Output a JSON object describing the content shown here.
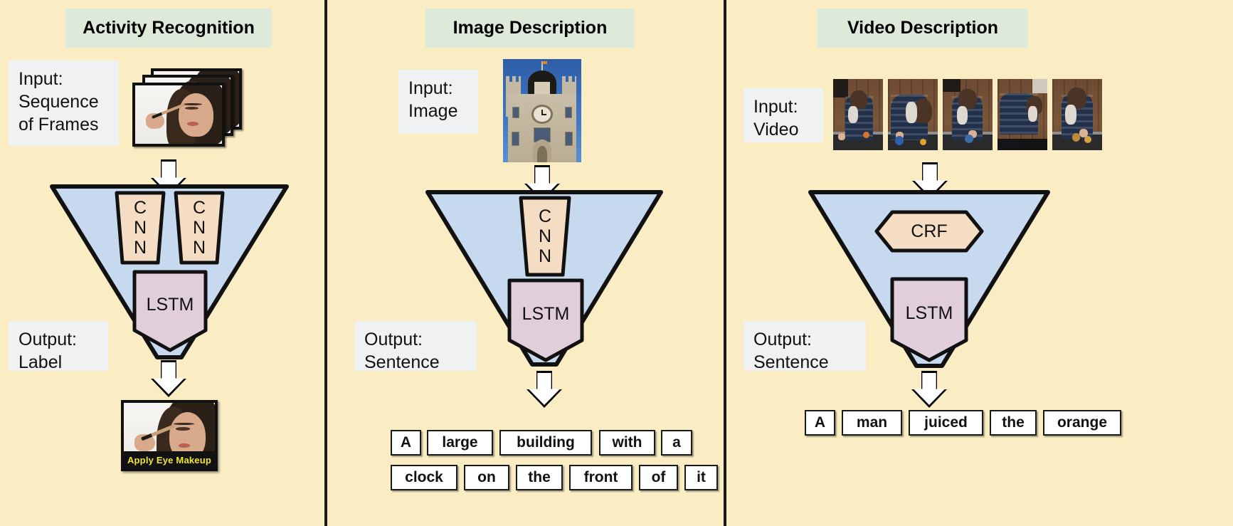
{
  "background_color": "#faedc4",
  "banner_color": "#ddeada",
  "label_box_color": "#f0f1f3",
  "funnel_color": "#c6d9ef",
  "cnn_color": "#f5ddc4",
  "lstm_color": "#e0cedb",
  "panels": [
    {
      "id": "activity",
      "title": "Activity Recognition",
      "input_label": "Input:\nSequence\nof Frames",
      "output_label": "Output:\nLabel",
      "input_media": "frame-stack-thumbnail",
      "output_media": "labeled-video-frame",
      "output_caption": "Apply Eye Makeup",
      "caption_text_color": "#f2e635",
      "nodes": [
        "CNN",
        "CNN",
        "LSTM"
      ],
      "words": []
    },
    {
      "id": "image",
      "title": "Image Description",
      "input_label": "Input:\nImage",
      "output_label": "Output:\nSentence",
      "input_media": "clock-tower-photo",
      "output_media": "word-boxes",
      "nodes": [
        "CNN",
        "LSTM"
      ],
      "words": [
        "A",
        "large",
        "building",
        "with",
        "a",
        "clock",
        "on",
        "the",
        "front",
        "of",
        "it"
      ]
    },
    {
      "id": "video",
      "title": "Video Description",
      "input_label": "Input:\nVideo",
      "output_label": "Output:\nSentence",
      "input_media": "video-frame-strip",
      "output_media": "word-boxes",
      "nodes": [
        "CRF",
        "LSTM"
      ],
      "words": [
        "A",
        "man",
        "juiced",
        "the",
        "orange"
      ]
    }
  ],
  "icons": {
    "arrow": "down-arrow-icon"
  }
}
